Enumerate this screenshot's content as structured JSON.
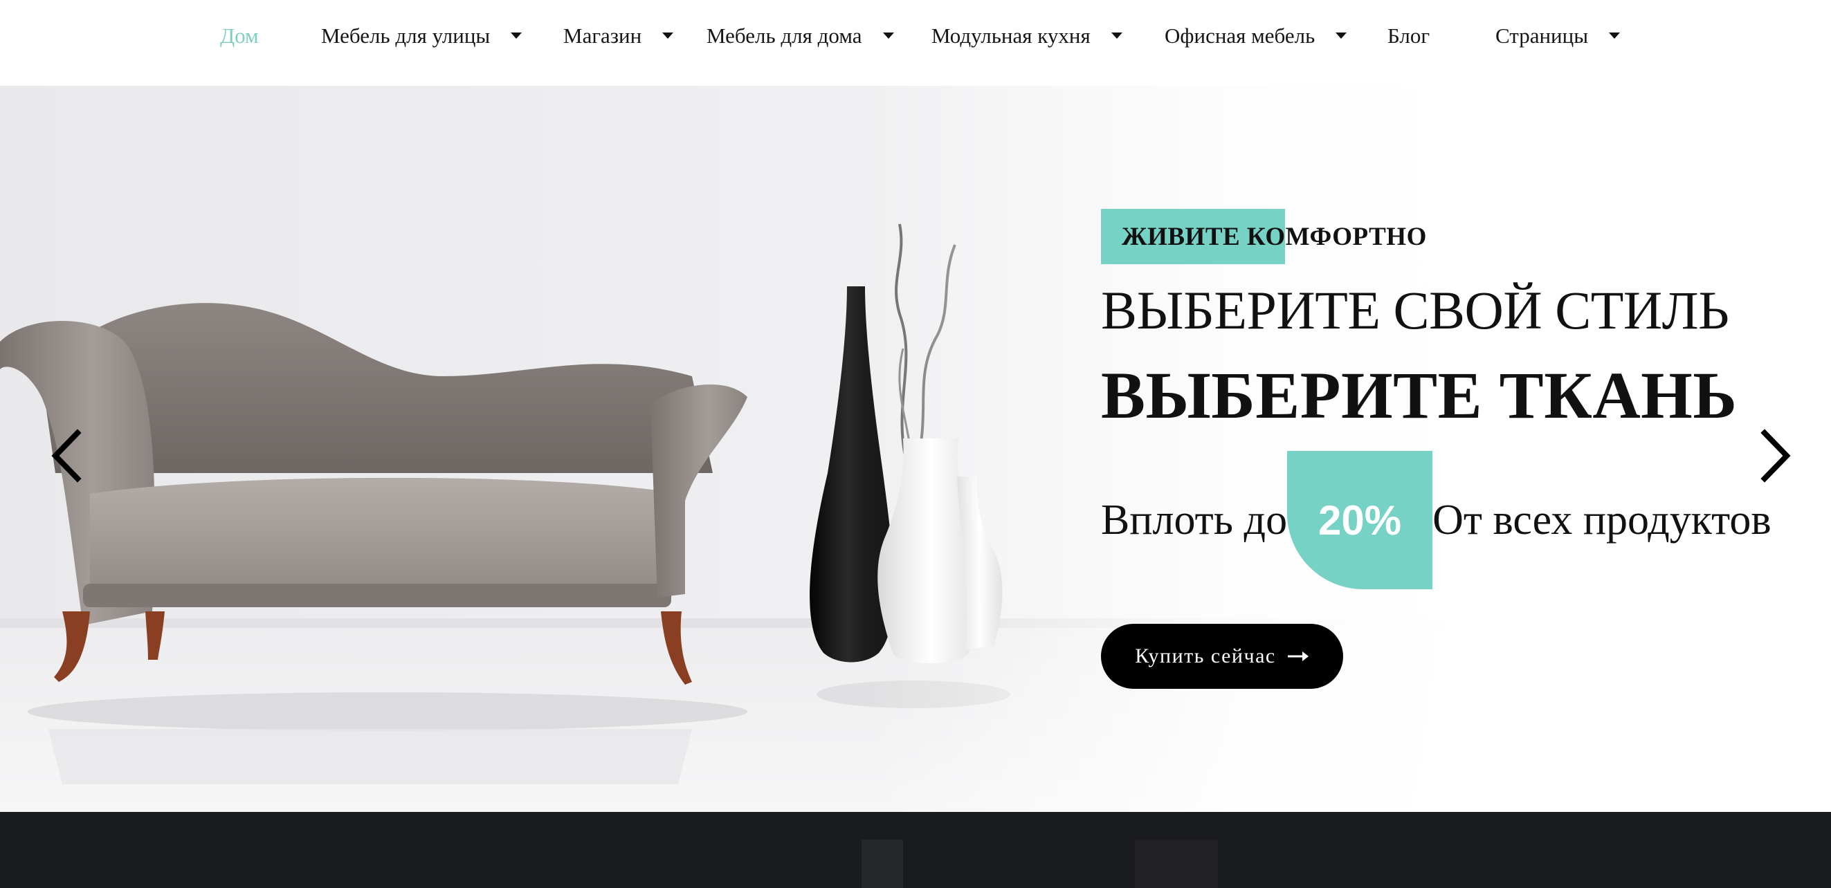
{
  "nav": {
    "items": [
      {
        "label": "Дом",
        "active": true,
        "has_dropdown": false
      },
      {
        "label": "Мебель для улицы",
        "active": false,
        "has_dropdown": true
      },
      {
        "label": "Магазин",
        "active": false,
        "has_dropdown": true
      },
      {
        "label": "Мебель для дома",
        "active": false,
        "has_dropdown": true
      },
      {
        "label": "Модульная кухня",
        "active": false,
        "has_dropdown": true
      },
      {
        "label": "Офисная мебель",
        "active": false,
        "has_dropdown": true
      },
      {
        "label": "Блог",
        "active": false,
        "has_dropdown": false
      },
      {
        "label": "Страницы",
        "active": false,
        "has_dropdown": true
      }
    ]
  },
  "hero": {
    "tag": "ЖИВИТЕ КОМФОРТНО",
    "headline_1": "ВЫБЕРИТЕ СВОЙ СТИЛЬ",
    "headline_2": "ВЫБЕРИТЕ ТКАНЬ",
    "promo_before": "Вплоть до",
    "promo_badge": "20%",
    "promo_after": "От всех продуктов",
    "cta_label": "Купить сейчас",
    "prev_icon": "chevron-left-icon",
    "next_icon": "chevron-right-icon",
    "cta_icon": "arrow-right-icon"
  },
  "colors": {
    "accent": "#76d2c5",
    "active_nav": "#7fcfc3",
    "button_bg": "#000000",
    "button_text": "#ffffff",
    "dark_band": "#1a1b1d"
  }
}
